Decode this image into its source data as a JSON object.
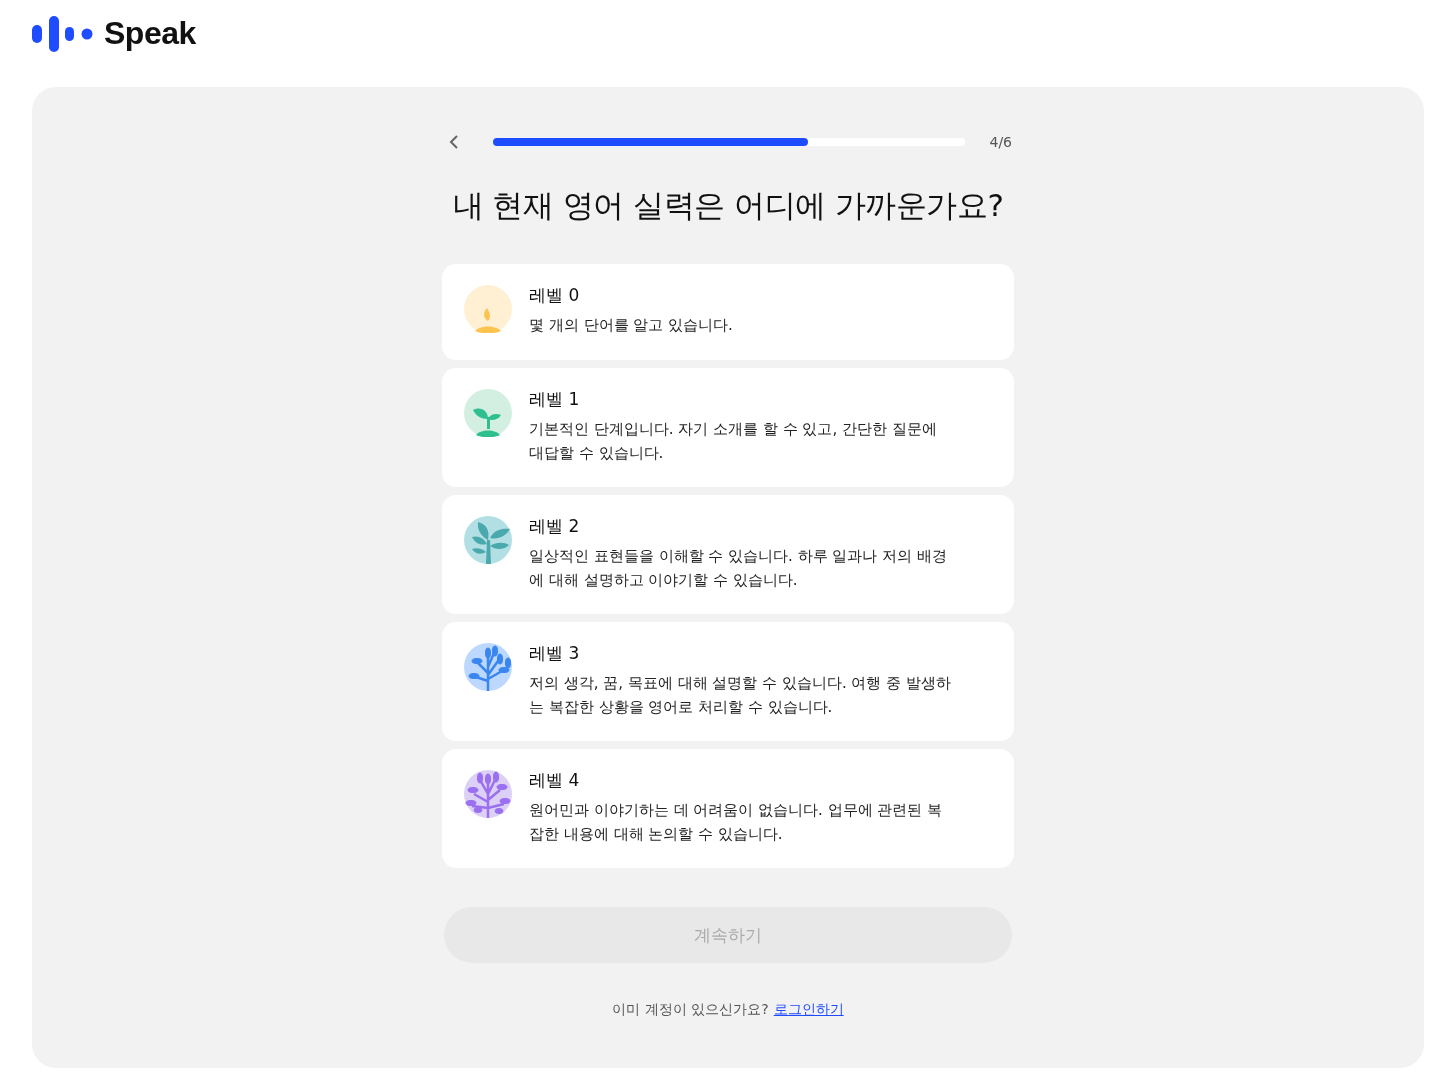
{
  "logo": {
    "text": "Speak"
  },
  "progress": {
    "level": 0.667,
    "counter": "4/6"
  },
  "question": "내 현재 영어 실력은 어디에 가까운가요?",
  "options": [
    {
      "title": "레벨 0",
      "description": "몇 개의 단어를 알고 있습니다.",
      "kind": "sprout",
      "color": "#fff0d4",
      "selected": false
    },
    {
      "title": "레벨 1",
      "description": "기본적인 단계입니다. 자기 소개를 할 수 있고, 간단한 질문에 대답할 수 있습니다.",
      "kind": "seedling",
      "color": "#d2efe2",
      "selected": false
    },
    {
      "title": "레벨 2",
      "description": "일상적인 표현들을 이해할 수 있습니다. 하루 일과나 저의 배경에 대해 설명하고 이야기할 수 있습니다.",
      "kind": "plant",
      "color": "#b2dfe3",
      "selected": false
    },
    {
      "title": "레벨 3",
      "description": "저의 생각, 꿈, 목표에 대해 설명할 수 있습니다. 여행 중 발생하는 복잡한 상황을 영어로 처리할 수 있습니다.",
      "kind": "tree",
      "color": "#bcd8ff",
      "selected": false
    },
    {
      "title": "레벨 4",
      "description": "원어민과 이야기하는 데 어려움이 없습니다. 업무에 관련된 복잡한 내용에 대해 논의할 수 있습니다.",
      "kind": "bush",
      "color": "#ddd0f7",
      "selected": false
    }
  ],
  "continue_button": {
    "label": "계속하기",
    "disabled": true
  },
  "login_prompt": {
    "text": "이미 계정이 있으신가요?",
    "link": "로그인하기"
  }
}
